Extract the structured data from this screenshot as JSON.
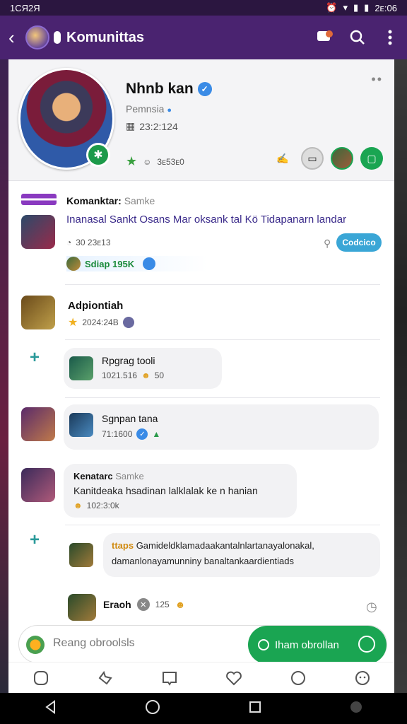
{
  "status_bar": {
    "time": "1CЯ2Я",
    "clock": "2ᴇ:06"
  },
  "app_bar": {
    "title": "Komunittas"
  },
  "profile": {
    "name": "Nhnb kan",
    "role": "Pemnsia",
    "date": "23:2:124",
    "stats": "3ᴇ53ᴇ0"
  },
  "posts": [
    {
      "label": "Komanktar:",
      "sub": "Samke",
      "text": "Inanasal Sankt Osans Mar oksank tal Kö Tidapanarn landar",
      "time": "30 23ᴇ13",
      "chip": "Codcico",
      "likes": "Sdiap 195K"
    },
    {
      "name": "Adpiontiah",
      "time": "2024:24B"
    },
    {
      "name": "Rpgrag tooli",
      "meta": "1021.516",
      "count": "50"
    },
    {
      "name": "Sgnpan tana",
      "meta": "71:1600"
    },
    {
      "name": "Kenatarc",
      "sub": "Samke",
      "text": "Kanitdeaka hsadinan lalklalak ke n hanian",
      "time": "102:3:0k"
    },
    {
      "tag": "ttaps",
      "text1": "Gamideldklamadaakantalnlartanayalonakal,",
      "text2": "damanlonayamunniny banaltankaardientiads"
    },
    {
      "name": "Eraoh",
      "meta": "125"
    }
  ],
  "compose": {
    "placeholder": "Reang obroolsls",
    "send_label": "Iham obrollan"
  },
  "colors": {
    "accent": "#4a2370",
    "green": "#1aa552",
    "blue": "#3a8be6",
    "teal": "#2a9a9a"
  }
}
